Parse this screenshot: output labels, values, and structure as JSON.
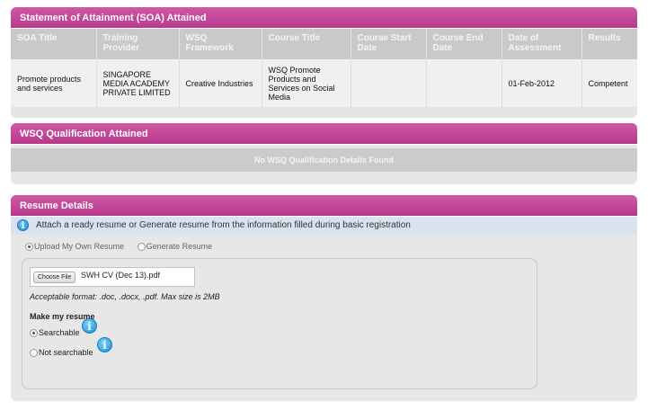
{
  "soa": {
    "title": "Statement of Attainment (SOA) Attained",
    "headers": [
      "SOA Title",
      "Training Provider",
      "WSQ Framework",
      "Course Title",
      "Course Start Date",
      "Course End Date",
      "Date of Assessment",
      "Results"
    ],
    "rows": [
      [
        "Promote products and services",
        "SINGAPORE MEDIA ACADEMY PRIVATE LIMITED",
        "Creative Industries",
        "WSQ Promote Products and Services on Social Media",
        "",
        "",
        "01-Feb-2012",
        "Competent"
      ]
    ]
  },
  "wsq": {
    "title": "WSQ Qualification Attained",
    "empty_message": "No WSQ Qualification Details Found"
  },
  "resume": {
    "title": "Resume Details",
    "info_text": "Attach a ready resume or Generate resume from the information filled during basic registration",
    "info_icon": "info-icon",
    "source_options": [
      {
        "label": "Upload My Own Resume",
        "checked": true
      },
      {
        "label": "Generate Resume",
        "checked": false
      }
    ],
    "choose_file_label": "Choose File",
    "file_name": "SWH CV (Dec 13).pdf",
    "acceptable_format": "Acceptable format: .doc, .docx, .pdf. Max size is 2MB",
    "make_resume_label": "Make my resume",
    "searchable_options": [
      {
        "label": "Searchable",
        "checked": true
      },
      {
        "label": "Not searchable",
        "checked": false
      }
    ]
  },
  "colors": {
    "header_magenta": "#c04797",
    "info_blue": "#1d88d0",
    "table_header_gray": "#c9c9c9"
  }
}
